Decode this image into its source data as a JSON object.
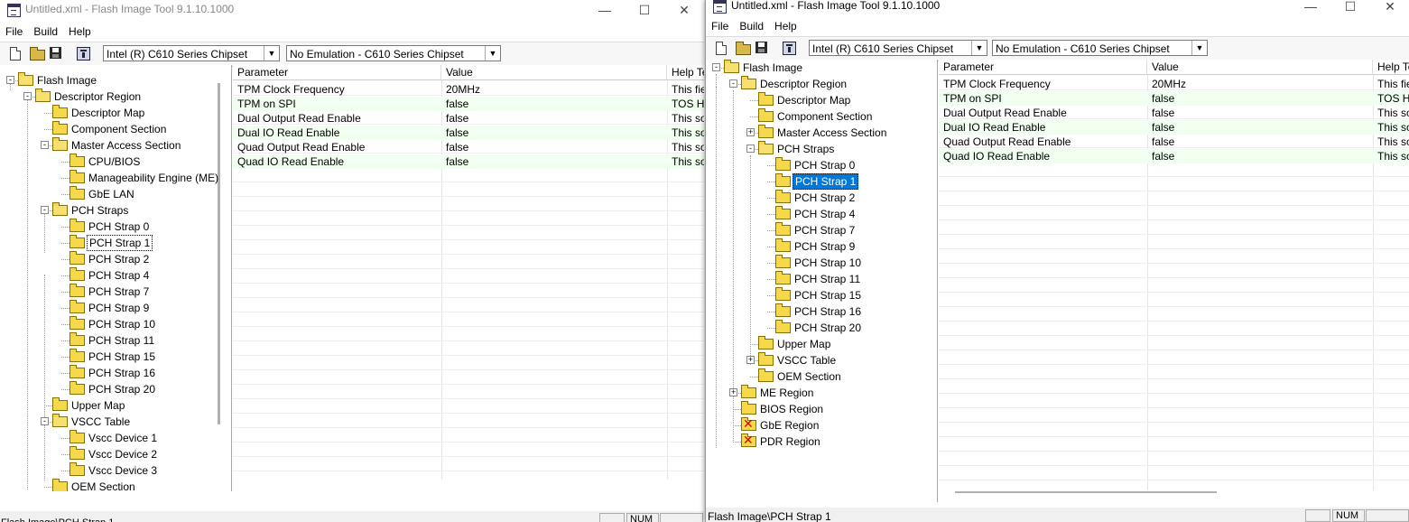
{
  "title": "Untitled.xml - Flash Image Tool 9.1.10.1000",
  "window_buttons": {
    "minimize": "—",
    "maximize": "☐",
    "close": "✕"
  },
  "menu": [
    "File",
    "Build",
    "Help"
  ],
  "chipset": "Intel (R) C610 Series Chipset",
  "emulation": "No Emulation - C610 Series Chipset",
  "columns": [
    "Parameter",
    "Value",
    "Help Text"
  ],
  "rows": [
    {
      "param": "TPM Clock Frequency",
      "value": "20MHz",
      "help": "This field"
    },
    {
      "param": "TPM on SPI",
      "value": "false",
      "help": "TOS Header"
    },
    {
      "param": "Dual Output Read Enable",
      "value": "false",
      "help": "This soft strap"
    },
    {
      "param": "Dual IO Read Enable",
      "value": "false",
      "help": "This soft strap"
    },
    {
      "param": "Quad Output Read Enable",
      "value": "false",
      "help": "This soft strap"
    },
    {
      "param": "Quad IO Read Enable",
      "value": "false",
      "help": "This soft strap"
    }
  ],
  "tree_left": [
    {
      "label": "Flash Image"
    },
    {
      "label": "Descriptor Region"
    },
    {
      "label": "Descriptor Map"
    },
    {
      "label": "Component Section"
    },
    {
      "label": "Master Access Section"
    },
    {
      "label": "CPU/BIOS"
    },
    {
      "label": "Manageability Engine (ME)"
    },
    {
      "label": "GbE LAN"
    },
    {
      "label": "PCH Straps"
    },
    {
      "label": "PCH Strap 0"
    },
    {
      "label": "PCH Strap 1"
    },
    {
      "label": "PCH Strap 2"
    },
    {
      "label": "PCH Strap 4"
    },
    {
      "label": "PCH Strap 7"
    },
    {
      "label": "PCH Strap 9"
    },
    {
      "label": "PCH Strap 10"
    },
    {
      "label": "PCH Strap 11"
    },
    {
      "label": "PCH Strap 15"
    },
    {
      "label": "PCH Strap 16"
    },
    {
      "label": "PCH Strap 20"
    },
    {
      "label": "Upper Map"
    },
    {
      "label": "VSCC Table"
    },
    {
      "label": "Vscc Device 1"
    },
    {
      "label": "Vscc Device 2"
    },
    {
      "label": "Vscc Device 3"
    },
    {
      "label": "OEM Section"
    }
  ],
  "tree_right": [
    {
      "label": "Flash Image"
    },
    {
      "label": "Descriptor Region"
    },
    {
      "label": "Descriptor Map"
    },
    {
      "label": "Component Section"
    },
    {
      "label": "Master Access Section"
    },
    {
      "label": "PCH Straps"
    },
    {
      "label": "PCH Strap 0"
    },
    {
      "label": "PCH Strap 1"
    },
    {
      "label": "PCH Strap 2"
    },
    {
      "label": "PCH Strap 4"
    },
    {
      "label": "PCH Strap 7"
    },
    {
      "label": "PCH Strap 9"
    },
    {
      "label": "PCH Strap 10"
    },
    {
      "label": "PCH Strap 11"
    },
    {
      "label": "PCH Strap 15"
    },
    {
      "label": "PCH Strap 16"
    },
    {
      "label": "PCH Strap 20"
    },
    {
      "label": "Upper Map"
    },
    {
      "label": "VSCC Table"
    },
    {
      "label": "OEM Section"
    },
    {
      "label": "ME Region"
    },
    {
      "label": "BIOS Region"
    },
    {
      "label": "GbE Region"
    },
    {
      "label": "PDR Region"
    }
  ],
  "status": {
    "path": "Flash Image\\PCH Strap 1",
    "num": "NUM"
  }
}
